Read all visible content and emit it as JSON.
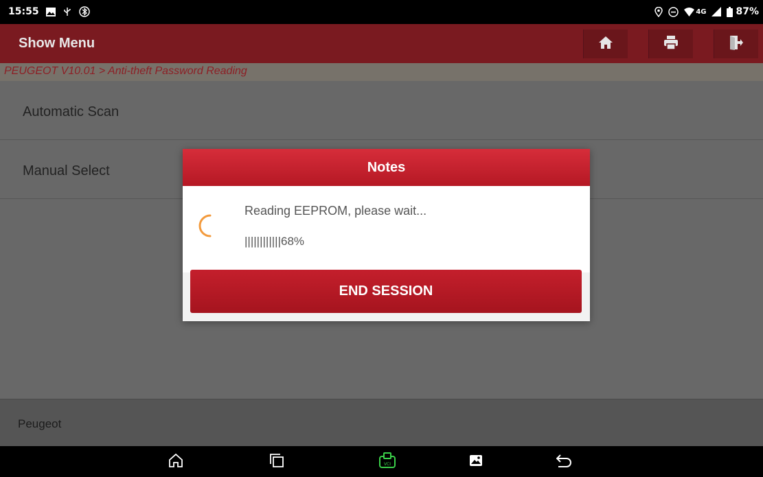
{
  "status_bar": {
    "time": "15:55",
    "network": "4G",
    "battery": "87%",
    "icons": [
      "image-icon",
      "usb-debug-icon",
      "bluetooth-icon",
      "location-icon",
      "do-not-disturb-icon",
      "wifi-icon",
      "signal-icon",
      "battery-icon"
    ]
  },
  "header": {
    "title": "Show Menu",
    "buttons": [
      "home-icon",
      "print-icon",
      "exit-icon"
    ]
  },
  "breadcrumb": "PEUGEOT V10.01 > Anti-theft Password Reading",
  "menu": {
    "items": [
      {
        "label": "Automatic Scan"
      },
      {
        "label": "Manual Select"
      }
    ]
  },
  "footer": {
    "label": "Peugeot"
  },
  "dialog": {
    "title": "Notes",
    "message": "Reading EEPROM, please wait...",
    "progress_text": "||||||||||||68%",
    "progress_percent": 68,
    "button_label": "END SESSION"
  },
  "nav_bar": {
    "buttons": [
      "home-icon",
      "recents-icon",
      "vci-icon",
      "gallery-icon",
      "back-icon"
    ]
  },
  "colors": {
    "header_bg": "#7a1a20",
    "dialog_header": "#c8202d",
    "button_red": "#b51a26",
    "spinner": "#f39a3c",
    "vci_green": "#3bd14a"
  }
}
